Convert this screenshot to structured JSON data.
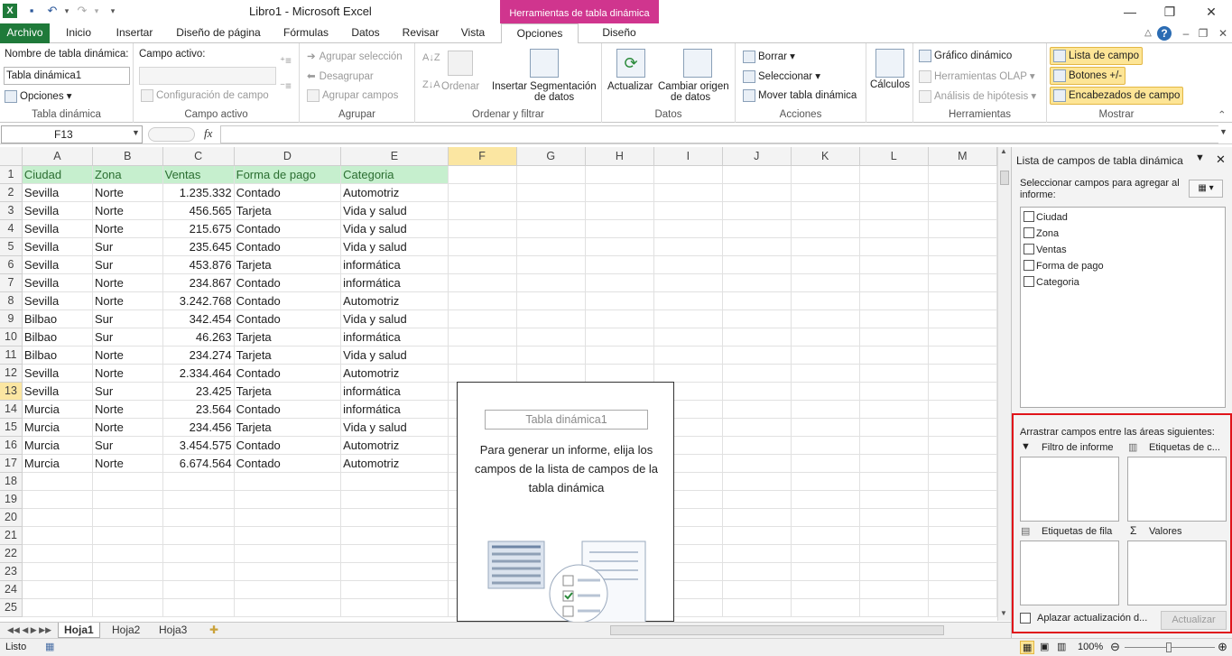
{
  "window": {
    "title": "Libro1  -  Microsoft Excel",
    "context_tab": "Herramientas de tabla dinámica"
  },
  "ribbon_tabs": [
    "Archivo",
    "Inicio",
    "Insertar",
    "Diseño de página",
    "Fórmulas",
    "Datos",
    "Revisar",
    "Vista",
    "Opciones",
    "Diseño"
  ],
  "ribbon": {
    "tabla_dinamica": {
      "name_label": "Nombre de tabla dinámica:",
      "name_value": "Tabla dinámica1",
      "opciones": "Opciones",
      "group": "Tabla dinámica"
    },
    "campo_activo": {
      "label": "Campo activo:",
      "config": "Configuración de campo",
      "group": "Campo activo"
    },
    "agrupar": {
      "agrupar_sel": "Agrupar selección",
      "desagrupar": "Desagrupar",
      "agrupar_campos": "Agrupar campos",
      "group": "Agrupar"
    },
    "ordenar": {
      "ordenar": "Ordenar",
      "insertar_seg_1": "Insertar Segmentación",
      "insertar_seg_2": "de datos",
      "group": "Ordenar y filtrar"
    },
    "datos": {
      "actualizar": "Actualizar",
      "cambiar_1": "Cambiar origen",
      "cambiar_2": "de datos",
      "group": "Datos"
    },
    "acciones": {
      "borrar": "Borrar",
      "seleccionar": "Seleccionar",
      "mover": "Mover tabla dinámica",
      "group": "Acciones"
    },
    "calculos": {
      "label": "Cálculos"
    },
    "herramientas": {
      "grafico": "Gráfico dinámico",
      "olap": "Herramientas OLAP",
      "hipotesis": "Análisis de hipótesis",
      "group": "Herramientas"
    },
    "mostrar": {
      "lista": "Lista de campo",
      "botones": "Botones +/-",
      "encabezados": "Encabezados de campo",
      "group": "Mostrar"
    }
  },
  "formula_bar": {
    "name_box": "F13",
    "fx": "fx",
    "value": ""
  },
  "columns": [
    "A",
    "B",
    "C",
    "D",
    "E",
    "F",
    "G",
    "H",
    "I",
    "J",
    "K",
    "L",
    "M"
  ],
  "rows": [
    [
      "Ciudad",
      "Zona",
      "Ventas",
      "Forma de pago",
      "Categoria"
    ],
    [
      "Sevilla",
      "Norte",
      "1.235.332",
      "Contado",
      "Automotriz"
    ],
    [
      "Sevilla",
      "Norte",
      "456.565",
      "Tarjeta",
      "Vida y salud"
    ],
    [
      "Sevilla",
      "Norte",
      "215.675",
      "Contado",
      "Vida y salud"
    ],
    [
      "Sevilla",
      "Sur",
      "235.645",
      "Contado",
      "Vida y salud"
    ],
    [
      "Sevilla",
      "Sur",
      "453.876",
      "Tarjeta",
      "informática"
    ],
    [
      "Sevilla",
      "Norte",
      "234.867",
      "Contado",
      "informática"
    ],
    [
      "Sevilla",
      "Norte",
      "3.242.768",
      "Contado",
      "Automotriz"
    ],
    [
      "Bilbao",
      "Sur",
      "342.454",
      "Contado",
      "Vida y salud"
    ],
    [
      "Bilbao",
      "Sur",
      "46.263",
      "Tarjeta",
      "informática"
    ],
    [
      "Bilbao",
      "Norte",
      "234.274",
      "Tarjeta",
      "Vida y salud"
    ],
    [
      "Sevilla",
      "Norte",
      "2.334.464",
      "Contado",
      "Automotriz"
    ],
    [
      "Sevilla",
      "Sur",
      "23.425",
      "Tarjeta",
      "informática"
    ],
    [
      "Murcia",
      "Norte",
      "23.564",
      "Contado",
      "informática"
    ],
    [
      "Murcia",
      "Norte",
      "234.456",
      "Tarjeta",
      "Vida y salud"
    ],
    [
      "Murcia",
      "Sur",
      "3.454.575",
      "Contado",
      "Automotriz"
    ],
    [
      "Murcia",
      "Norte",
      "6.674.564",
      "Contado",
      "Automotriz"
    ]
  ],
  "row_count": 25,
  "pivot": {
    "title": "Tabla dinámica1",
    "message": "Para generar un informe, elija los campos de la lista de campos de la tabla dinámica"
  },
  "sheet_tabs": [
    "Hoja1",
    "Hoja2",
    "Hoja3"
  ],
  "status": {
    "ready": "Listo",
    "zoom": "100%"
  },
  "pane": {
    "title": "Lista de campos de tabla dinámica",
    "select_label": "Seleccionar campos para agregar al informe:",
    "fields": [
      "Ciudad",
      "Zona",
      "Ventas",
      "Forma de pago",
      "Categoria"
    ],
    "drag_label": "Arrastrar campos entre las áreas siguientes:",
    "filtro": "Filtro de informe",
    "etiquetas_col": "Etiquetas de c...",
    "etiquetas_fila": "Etiquetas de fila",
    "valores": "Valores",
    "aplazar": "Aplazar actualización d...",
    "actualizar": "Actualizar"
  },
  "colors": {
    "accent": "#1f7a3a",
    "context": "#d0358e",
    "header_fill": "#c6efce",
    "highlight_box": "#e0141a"
  }
}
